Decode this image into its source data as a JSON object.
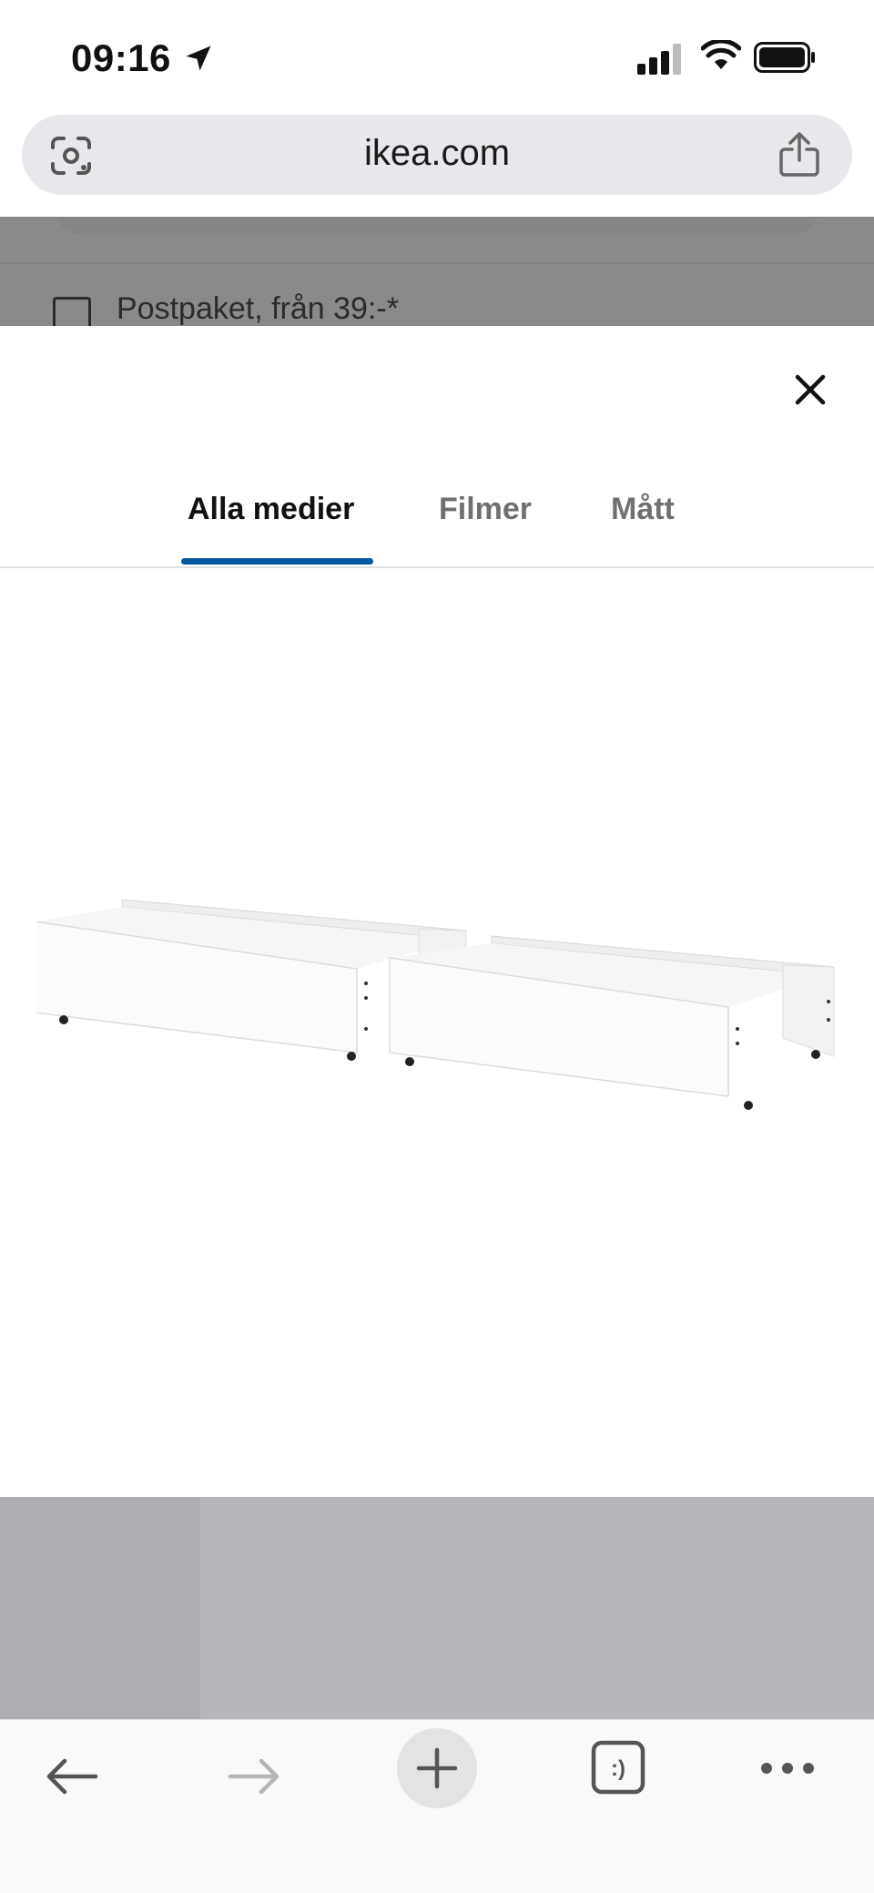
{
  "status": {
    "time": "09:16"
  },
  "browser": {
    "url": "ikea.com"
  },
  "background_page": {
    "delivery_text": "Postpaket, från 39:-*"
  },
  "modal": {
    "tabs": [
      {
        "label": "Alla medier",
        "active": true
      },
      {
        "label": "Filmer",
        "active": false
      },
      {
        "label": "Mått",
        "active": false
      }
    ],
    "accent_color": "#0058a3"
  },
  "icons": {
    "status": [
      "location-arrow-icon",
      "cellular-signal-icon",
      "wifi-icon",
      "battery-icon"
    ],
    "url_bar": [
      "google-lens-icon",
      "share-icon"
    ],
    "modal": [
      "close-icon"
    ],
    "toolbar": [
      "back-arrow-icon",
      "forward-arrow-icon",
      "plus-icon",
      "tab-switcher-icon",
      "more-dots-icon"
    ]
  },
  "toolbar": {
    "tab_switcher_glyph": ":)"
  }
}
